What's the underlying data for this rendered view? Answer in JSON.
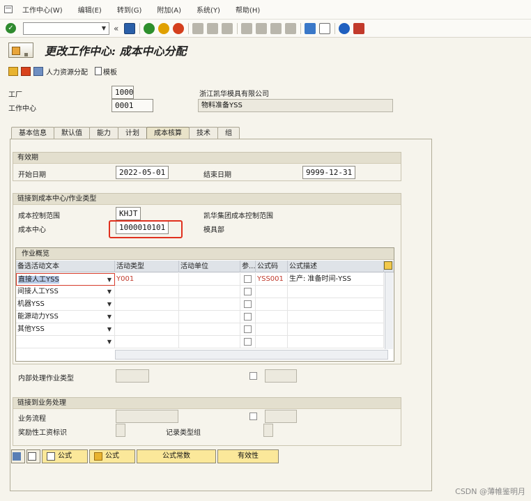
{
  "menubar": {
    "items": [
      "工作中心(W)",
      "编辑(E)",
      "转到(G)",
      "附加(A)",
      "系统(Y)",
      "帮助(H)"
    ]
  },
  "toolbar": {
    "command_value": "",
    "icons": [
      "ok-icon",
      "save-icon",
      "back-icon",
      "exit-icon",
      "cancel-icon",
      "print-icon",
      "find-icon",
      "find-next-icon",
      "first-page-icon",
      "prev-page-icon",
      "next-page-icon",
      "last-page-icon",
      "new-session-icon",
      "shortcut-icon",
      "help-icon",
      "layout-icon"
    ]
  },
  "title": "更改工作中心: 成本中心分配",
  "app_toolbar": {
    "hr_label": "人力资源分配",
    "template_label": "模板"
  },
  "header": {
    "plant_label": "工厂",
    "plant_value": "1000",
    "plant_desc": "浙江凯华模具有限公司",
    "wc_label": "工作中心",
    "wc_value": "0001",
    "wc_desc": "物料准备YSS"
  },
  "tabs": [
    "基本信息",
    "默认值",
    "能力",
    "计划",
    "成本核算",
    "技术",
    "组"
  ],
  "active_tab": "成本核算",
  "validity": {
    "title": "有效期",
    "start_label": "开始日期",
    "start_value": "2022-05-01",
    "end_label": "结束日期",
    "end_value": "9999-12-31"
  },
  "link_cc": {
    "title": "链接到成本中心/作业类型",
    "ca_label": "成本控制范围",
    "ca_value": "KHJT",
    "ca_desc": "凯华集团成本控制范围",
    "cc_label": "成本中心",
    "cc_value": "1000010101",
    "cc_desc": "模具部"
  },
  "activity_table": {
    "title": "作业概览",
    "columns": [
      "备选活动文本",
      "活动类型",
      "活动单位",
      "参...",
      "公式码",
      "公式描述"
    ],
    "rows": [
      {
        "text": "直接人工YSS",
        "activity_type": "Y001",
        "unit": "",
        "formula": "YSS001",
        "formula_desc": "生产: 准备时间-YSS"
      },
      {
        "text": "间接人工YSS",
        "activity_type": "",
        "unit": "",
        "formula": "",
        "formula_desc": ""
      },
      {
        "text": "机器YSS",
        "activity_type": "",
        "unit": "",
        "formula": "",
        "formula_desc": ""
      },
      {
        "text": "能源动力YSS",
        "activity_type": "",
        "unit": "",
        "formula": "",
        "formula_desc": ""
      },
      {
        "text": "其他YSS",
        "activity_type": "",
        "unit": "",
        "formula": "",
        "formula_desc": ""
      },
      {
        "text": "",
        "activity_type": "",
        "unit": "",
        "formula": "",
        "formula_desc": ""
      }
    ]
  },
  "internal": {
    "label": "内部处理作业类型"
  },
  "link_bp": {
    "title": "链接到业务处理",
    "process_label": "业务流程",
    "incentive_label": "奖励性工资标识",
    "record_label": "记录类型组"
  },
  "buttons": {
    "formula1": "公式",
    "formula2": "公式",
    "formula_const": "公式常数",
    "validity": "有效性"
  },
  "watermark": "CSDN @薄帷鉴明月"
}
